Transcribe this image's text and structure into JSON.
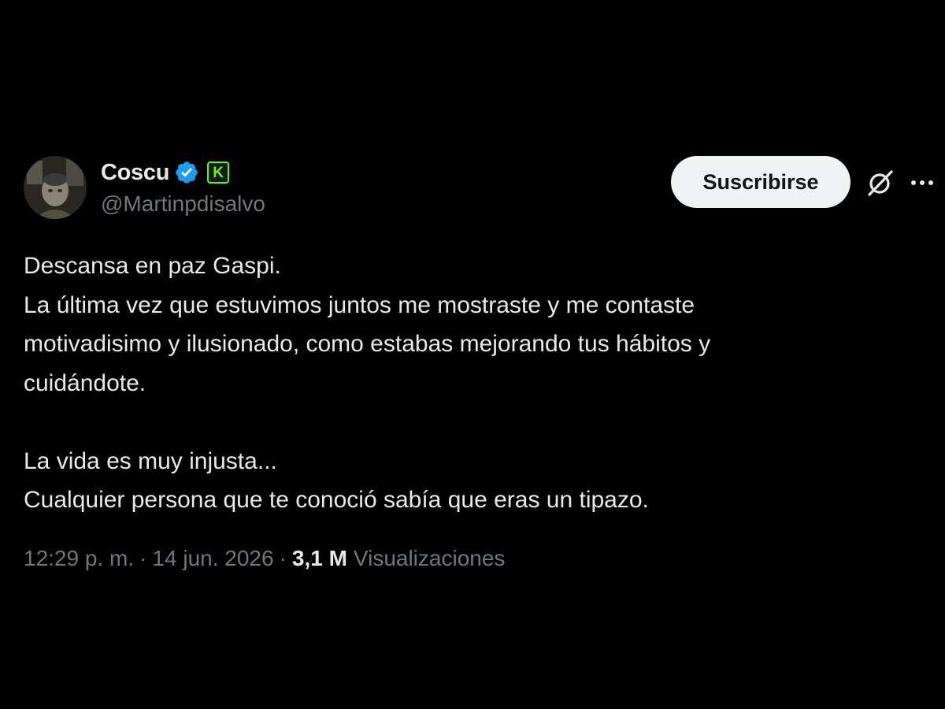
{
  "author": {
    "display_name": "Coscu",
    "handle": "@Martinpdisalvo",
    "avatar_icon": "profile-avatar",
    "verified_icon": "verified-badge-icon",
    "verified_color": "#1d9bf0",
    "affiliate_badge": {
      "icon": "kick-icon",
      "letter": "K",
      "color": "#53fc18"
    }
  },
  "actions": {
    "subscribe_label": "Suscribirse",
    "grok_icon": "grok-icon",
    "more_icon": "more-icon"
  },
  "tweet": {
    "paragraph_1": "Descansa en paz Gaspi.\nLa última vez que estuvimos juntos me mostraste y me contaste\nmotivadisimo y ilusionado, como estabas mejorando tus hábitos y\ncuidándote.",
    "paragraph_2": "La vida es muy injusta...\nCualquier persona que te conoció sabía que eras un tipazo."
  },
  "meta": {
    "time": "12:29 p. m.",
    "separator": "·",
    "date": "14 jun. 2026",
    "views_count": "3,1 M",
    "views_label": "Visualizaciones"
  },
  "colors": {
    "background": "#000000",
    "text_primary": "#e7e9ea",
    "text_secondary": "#71767b",
    "button_bg": "#eff3f4",
    "button_text": "#0f1419"
  }
}
